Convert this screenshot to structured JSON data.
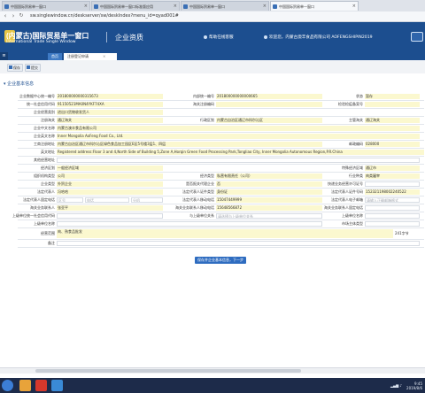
{
  "browser": {
    "tabs": [
      {
        "label": "中国国际贸易单一窗口"
      },
      {
        "label": "中国国际贸易单一窗口标准版应用"
      },
      {
        "label": "中国国际贸易单一窗口"
      },
      {
        "label": "中国国际贸易单一窗口"
      }
    ],
    "url": "sw.singlewindow.cn/deskserver/sw/deskIndex?menu_id=qyad001#"
  },
  "header": {
    "brand": "(内蒙古)国际贸易单一窗口",
    "brand_sub": "International Trade Single Window",
    "module": "企业资质",
    "link_help": "帮助在线客服",
    "welcome": "欢迎您，内蒙古澳丰食品有限公司 AOFENGSHIPIN2019"
  },
  "subnav": {
    "home": "首页",
    "current": "注册登记申请"
  },
  "toolbar": {
    "btn1": "保存",
    "btn2": "提交"
  },
  "section_title": "企业基本信息",
  "form": {
    "r1": {
      "l1": "企业数据中心统一编号",
      "v1": "201800000000315673",
      "l2": "内部统一编号",
      "v2": "201800000000000665",
      "l3": "状态",
      "v3": "暂存"
    },
    "r2": {
      "l1": "统一社会信用代码",
      "v1": "91150521MA0N4YKF74XA",
      "l2": "海关注册编码",
      "v2": "",
      "l3": "检验检疫备案号",
      "v3": ""
    },
    "r3": {
      "l1": "企业经营类别",
      "v1": "进出口货物收发货人",
      "l2": "",
      "v2": "",
      "l3": "",
      "v3": ""
    },
    "r4": {
      "l1": "注册海关",
      "v1": "通辽海关",
      "l2": "行政区划",
      "v2": "内蒙古自治区通辽市科尔沁区",
      "l3": "主管海关",
      "v3": "通辽海关"
    },
    "r5": {
      "l1": "企业中文名称",
      "v1": "内蒙古澳丰食品有限公司"
    },
    "r6": {
      "l1": "企业英文名称",
      "v1": "Inner Mongolia AoFeng Food Co., Ltd."
    },
    "r7": {
      "l1": "工商注册地址",
      "v1": "内蒙古自治区通辽市科尔沁区绿色食品加工园区E区5号楼3层1、四层",
      "l2": "邮政编码",
      "v2": "028000"
    },
    "r8": {
      "l1": "英文地址",
      "v1": "Registered address:Floor 3 and 4,North Side of Building 5,Zone A,Horqin Green Food Processing Park,Tongliao City, Inner Mongolia Autonomous Region,P.R.China"
    },
    "r9": {
      "l1": "其他经营地址",
      "v1": ""
    },
    "r10": {
      "l1": "经济区划",
      "v1": "一般经济区域",
      "l2": "",
      "v2": "",
      "l3": "特殊经济区域",
      "v3": "通辽市"
    },
    "r11": {
      "l1": "组织机构类型",
      "v1": "公司",
      "l2": "经济类型",
      "v2": "私营有限责任（公司）",
      "l3": "行业种类",
      "v3": "肉类屠宰"
    },
    "r12": {
      "l1": "企业类型",
      "v1": "外贸企业",
      "l2": "是否报关代理企业",
      "v2": "否",
      "l3": "快递业务经营许可证号",
      "v3": ""
    },
    "r13": {
      "l1": "法定代表人",
      "v1": "冯哈哈",
      "l2": "法定代表人证件类型",
      "v2": "身份证",
      "l3": "法定代表人证件号码",
      "v3": "152321198002240522"
    },
    "r14": {
      "l1": "法定代表人固定电话",
      "v1": "",
      "p1a": "区号",
      "p1b": "电话",
      "p1c": "分机",
      "l2": "法定代表人移动电话",
      "v2": "15047449999",
      "l3": "法定代表人电子邮箱",
      "v3": "",
      "p3": "请输入正确邮箱格式"
    },
    "r15": {
      "l1": "海关业务联系人",
      "v1": "张亚平",
      "l2": "海关业务联系人移动电话",
      "v2": "15648566872",
      "l3": "海关业务联系人固定电话",
      "v3": ""
    },
    "r16": {
      "l1": "上级单位统一社会信用代码",
      "v1": "",
      "l2": "与上级单位关系",
      "v2": "",
      "p2": "请选择与上级单位关系",
      "l3": "上级单位名称",
      "v3": ""
    },
    "r17": {
      "l1": "上级单位名称",
      "v1": "",
      "l3": "市场主体类型",
      "v3": ""
    },
    "r18": {
      "l1": "经营范围",
      "v1": "肉、熟食品批发",
      "counter": "241字节"
    },
    "r19": {
      "l1": "备注",
      "v1": ""
    }
  },
  "submit_label": "保存并企业基本信息，下一步",
  "taskbar": {
    "time": "9:45",
    "date": "2019/8/6"
  }
}
